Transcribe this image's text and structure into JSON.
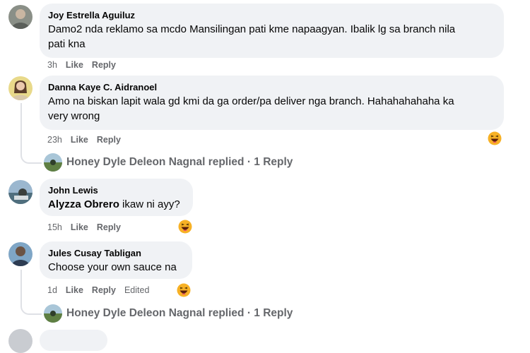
{
  "comments": [
    {
      "author": "Joy Estrella Aguiluz",
      "text_line1": "Damo2 nda reklamo sa mcdo Mansilingan pati kme napaagyan. Ibalik lg sa branch nila",
      "text_line2": "pati kna",
      "time": "3h",
      "like": "Like",
      "reply": "Reply"
    },
    {
      "author": "Danna Kaye C. Aidranoel",
      "text_line1": "Amo na biskan lapit wala gd kmi da ga order/pa deliver nga branch. Hahahahahaha ka",
      "text_line2": "very wrong",
      "time": "23h",
      "like": "Like",
      "reply": "Reply",
      "reaction": "haha"
    },
    {
      "author": "John Lewis",
      "mention": "Alyzza Obrero",
      "text_rest": " ikaw ni ayy?",
      "time": "15h",
      "like": "Like",
      "reply": "Reply",
      "reaction": "haha"
    },
    {
      "author": "Jules Cusay Tabligan",
      "text": "Choose your own sauce na",
      "time": "1d",
      "like": "Like",
      "reply": "Reply",
      "edited": "Edited",
      "reaction": "haha"
    }
  ],
  "replies_summary": [
    {
      "text": "Honey Dyle Deleon Nagnal replied · 1 Reply"
    },
    {
      "text": "Honey Dyle Deleon Nagnal replied · 1 Reply"
    }
  ],
  "colors": {
    "bubble": "#f0f2f5",
    "meta": "#65676b",
    "thread_line": "#dfe1e6",
    "haha_face": "#f7b125"
  }
}
